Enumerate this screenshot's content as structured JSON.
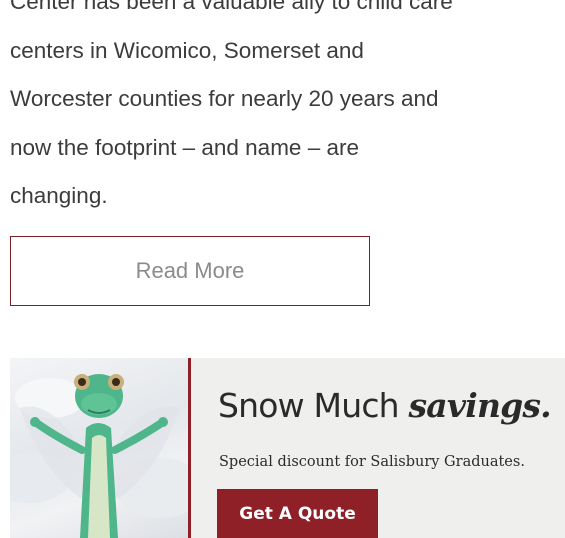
{
  "article": {
    "excerpt_lines": [
      "Center has been a valuable ally to child care",
      "centers in Wicomico, Somerset and",
      "Worcester counties for nearly 20 years and",
      "now the footprint – and name – are",
      "changing."
    ],
    "read_more_label": "Read More"
  },
  "ad": {
    "headline_plain": "Snow Much ",
    "headline_emphasis": "savings.",
    "subtext": "Special discount for Salisbury Graduates.",
    "cta_label": "Get A Quote",
    "image_icon": "gecko-snow-angel-illustration",
    "colors": {
      "accent": "#8f2028",
      "background": "#efefed",
      "gecko_green": "#4fb58a"
    }
  }
}
